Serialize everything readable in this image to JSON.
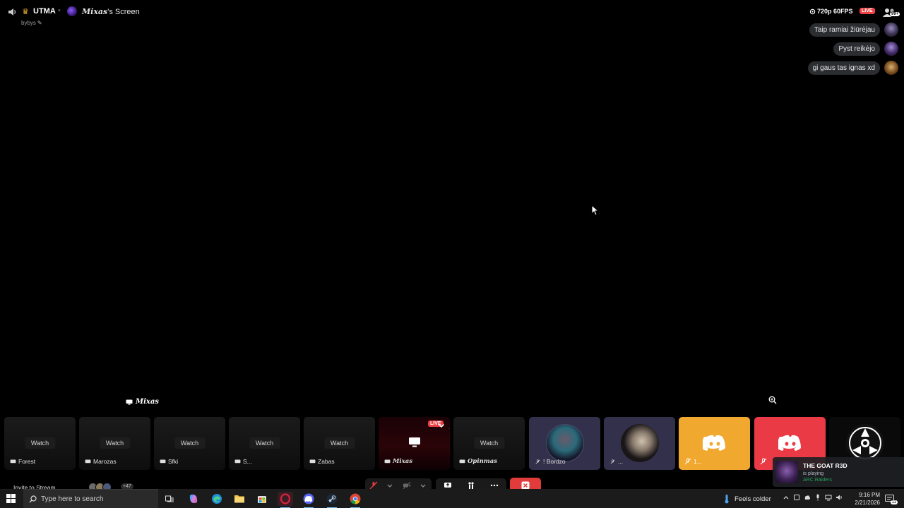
{
  "header": {
    "server_name": "UTMA",
    "streamer_nick": "𝑴𝒊𝒙𝒂𝒔",
    "screen_suffix": "'s Screen",
    "subtitle": "bybys",
    "quality": "720p 60FPS",
    "live_badge": "LIVE",
    "viewer_badge": "99+"
  },
  "chat": [
    {
      "text": "Taip ramiai žiūrėjau"
    },
    {
      "text": "Pyst reikėjo"
    },
    {
      "text": "gi gaus tas ignas xd"
    }
  ],
  "stream_label": "𝑴𝒊𝒙𝒂𝒔",
  "tiles": [
    {
      "name": "Forest",
      "action": "Watch"
    },
    {
      "name": "Marozas",
      "action": "Watch"
    },
    {
      "name": "Sfki",
      "action": "Watch"
    },
    {
      "name": "S...",
      "action": "Watch"
    },
    {
      "name": "Zabas",
      "action": "Watch"
    },
    {
      "name": "𝑴𝒊𝒙𝒂𝒔",
      "badge": "LIVE"
    },
    {
      "name": "𝑶𝒑𝒊𝒏𝒎𝒂𝒔",
      "action": "Watch"
    },
    {
      "name": "! Bordzo"
    },
    {
      "name": "..."
    },
    {
      "name": "1..."
    },
    {
      "name": ""
    },
    {
      "name": ""
    }
  ],
  "footer": {
    "invite": "Invite to Stream",
    "viewer_count": "+47"
  },
  "notification": {
    "title": "THE GOAT R3D",
    "subtitle": "is playing",
    "game": "ARC Raiders"
  },
  "taskbar": {
    "search_placeholder": "Type here to search",
    "weather": "Feels colder",
    "time": "9:16 PM",
    "date": "2/21/2026",
    "notif_count": "11"
  },
  "icons": {
    "volume": "speaker-icon",
    "crown": "crown-icon",
    "quality": "eye-icon",
    "people": "people-icon",
    "zoom": "magnifier-plus-icon",
    "cursor": "mouse-pointer-icon"
  },
  "colors": {
    "live": "#ed4245",
    "discord_orange": "#f0a82e",
    "discord_red": "#ea3a46",
    "end_call": "#e23b3b",
    "playing_green": "#23a55a"
  }
}
